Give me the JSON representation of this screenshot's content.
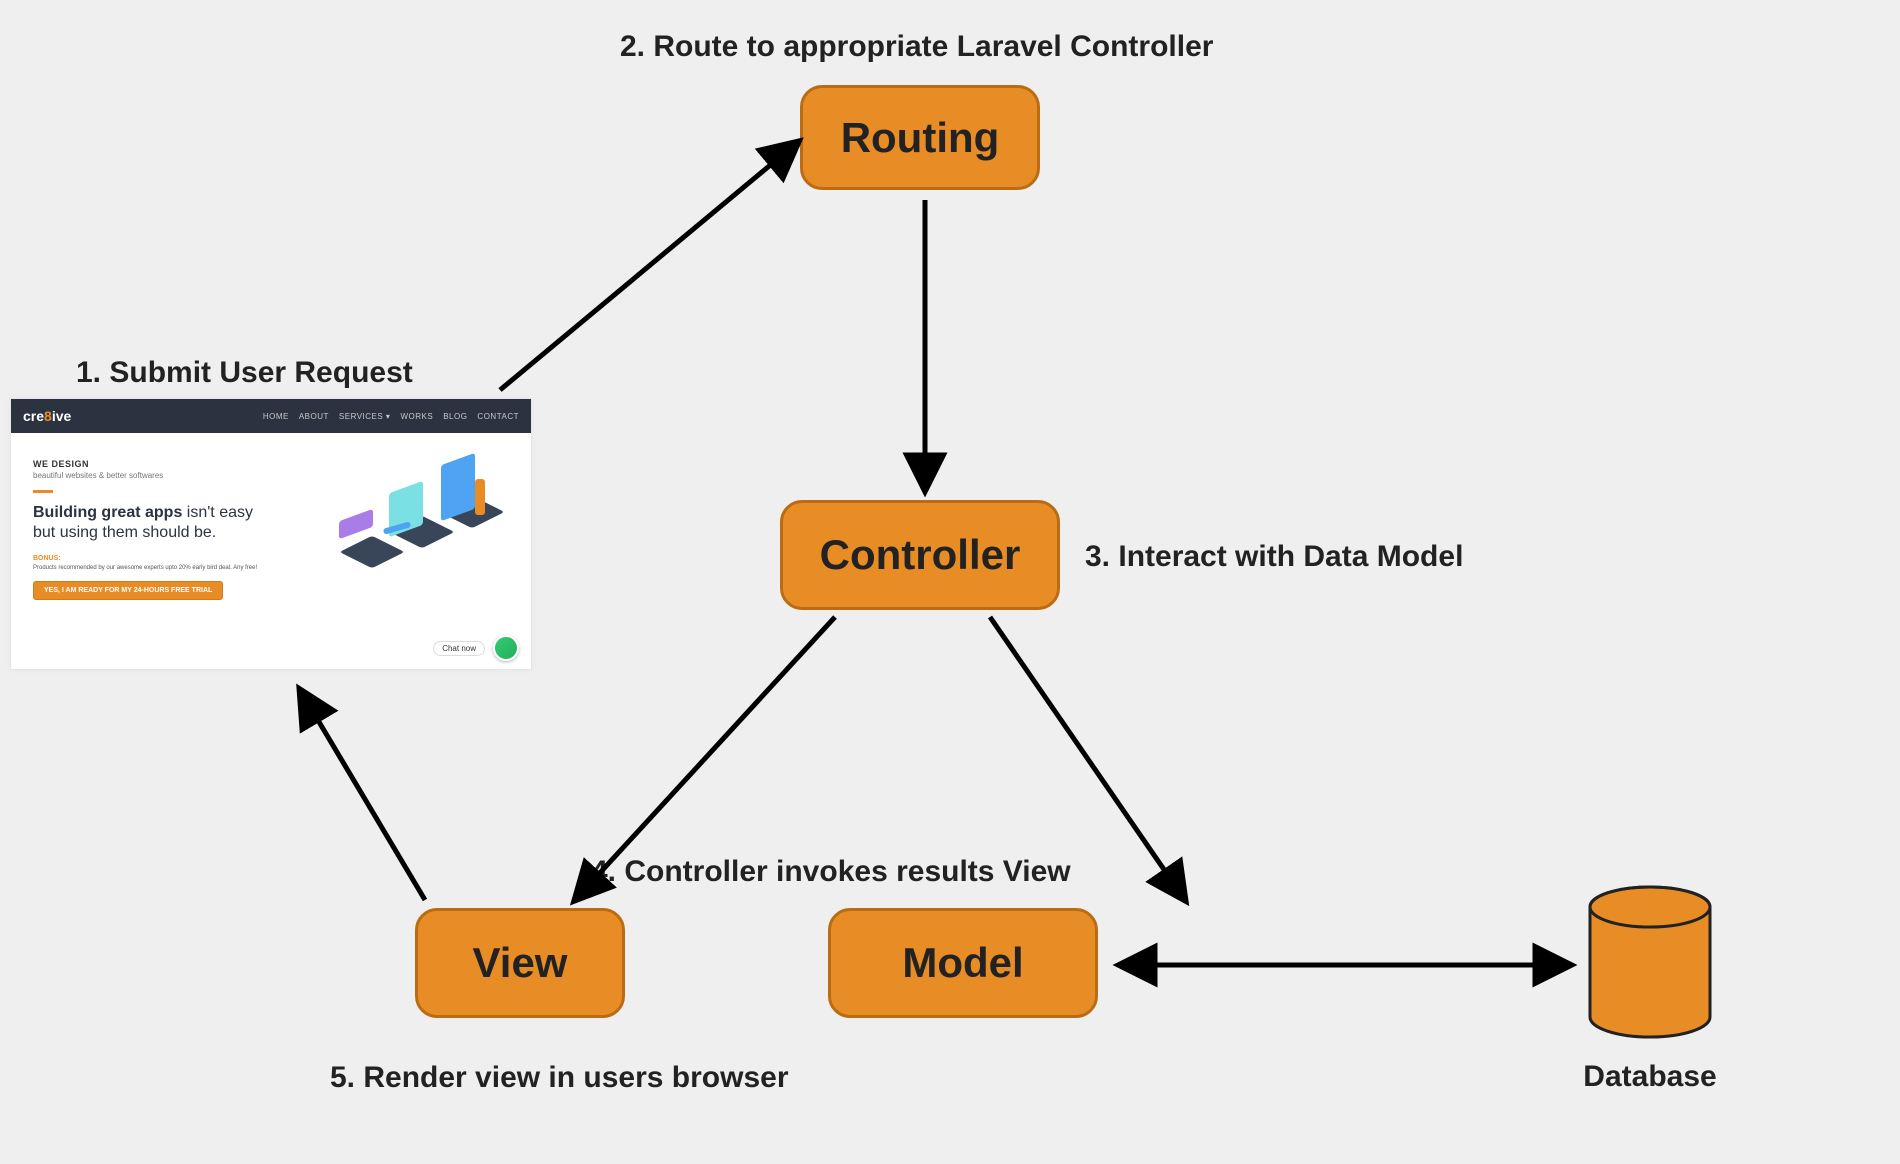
{
  "labels": {
    "step1": "1. Submit User Request",
    "step2": "2. Route to appropriate Laravel Controller",
    "step3": "3. Interact with Data Model",
    "step4": "4. Controller invokes results View",
    "step5": "5. Render view in users browser",
    "db": "Database"
  },
  "nodes": {
    "routing": "Routing",
    "controller": "Controller",
    "model": "Model",
    "view": "View"
  },
  "browser_thumb": {
    "brand_prefix": "cre",
    "brand_accent": "8",
    "brand_suffix": "ive",
    "nav": {
      "home": "HOME",
      "about": "ABOUT",
      "services": "SERVICES ▾",
      "works": "WORKS",
      "blog": "BLOG",
      "contact": "CONTACT"
    },
    "kicker": "WE DESIGN",
    "sub": "beautiful websites & better softwares",
    "heading_bold": "Building great apps",
    "heading_rest_line1": " isn't easy",
    "heading_rest_line2": "but using them should be.",
    "bonus_label": "BONUS:",
    "bonus_text": "Products recommended by our awesome experts upto 20% early bird deal. Any free!",
    "cta": "YES, I AM READY FOR MY 24-HOURS FREE TRIAL",
    "chat": "Chat now"
  },
  "colors": {
    "node_fill": "#e88d25",
    "node_border": "#b96c14",
    "bg": "#efefef"
  }
}
